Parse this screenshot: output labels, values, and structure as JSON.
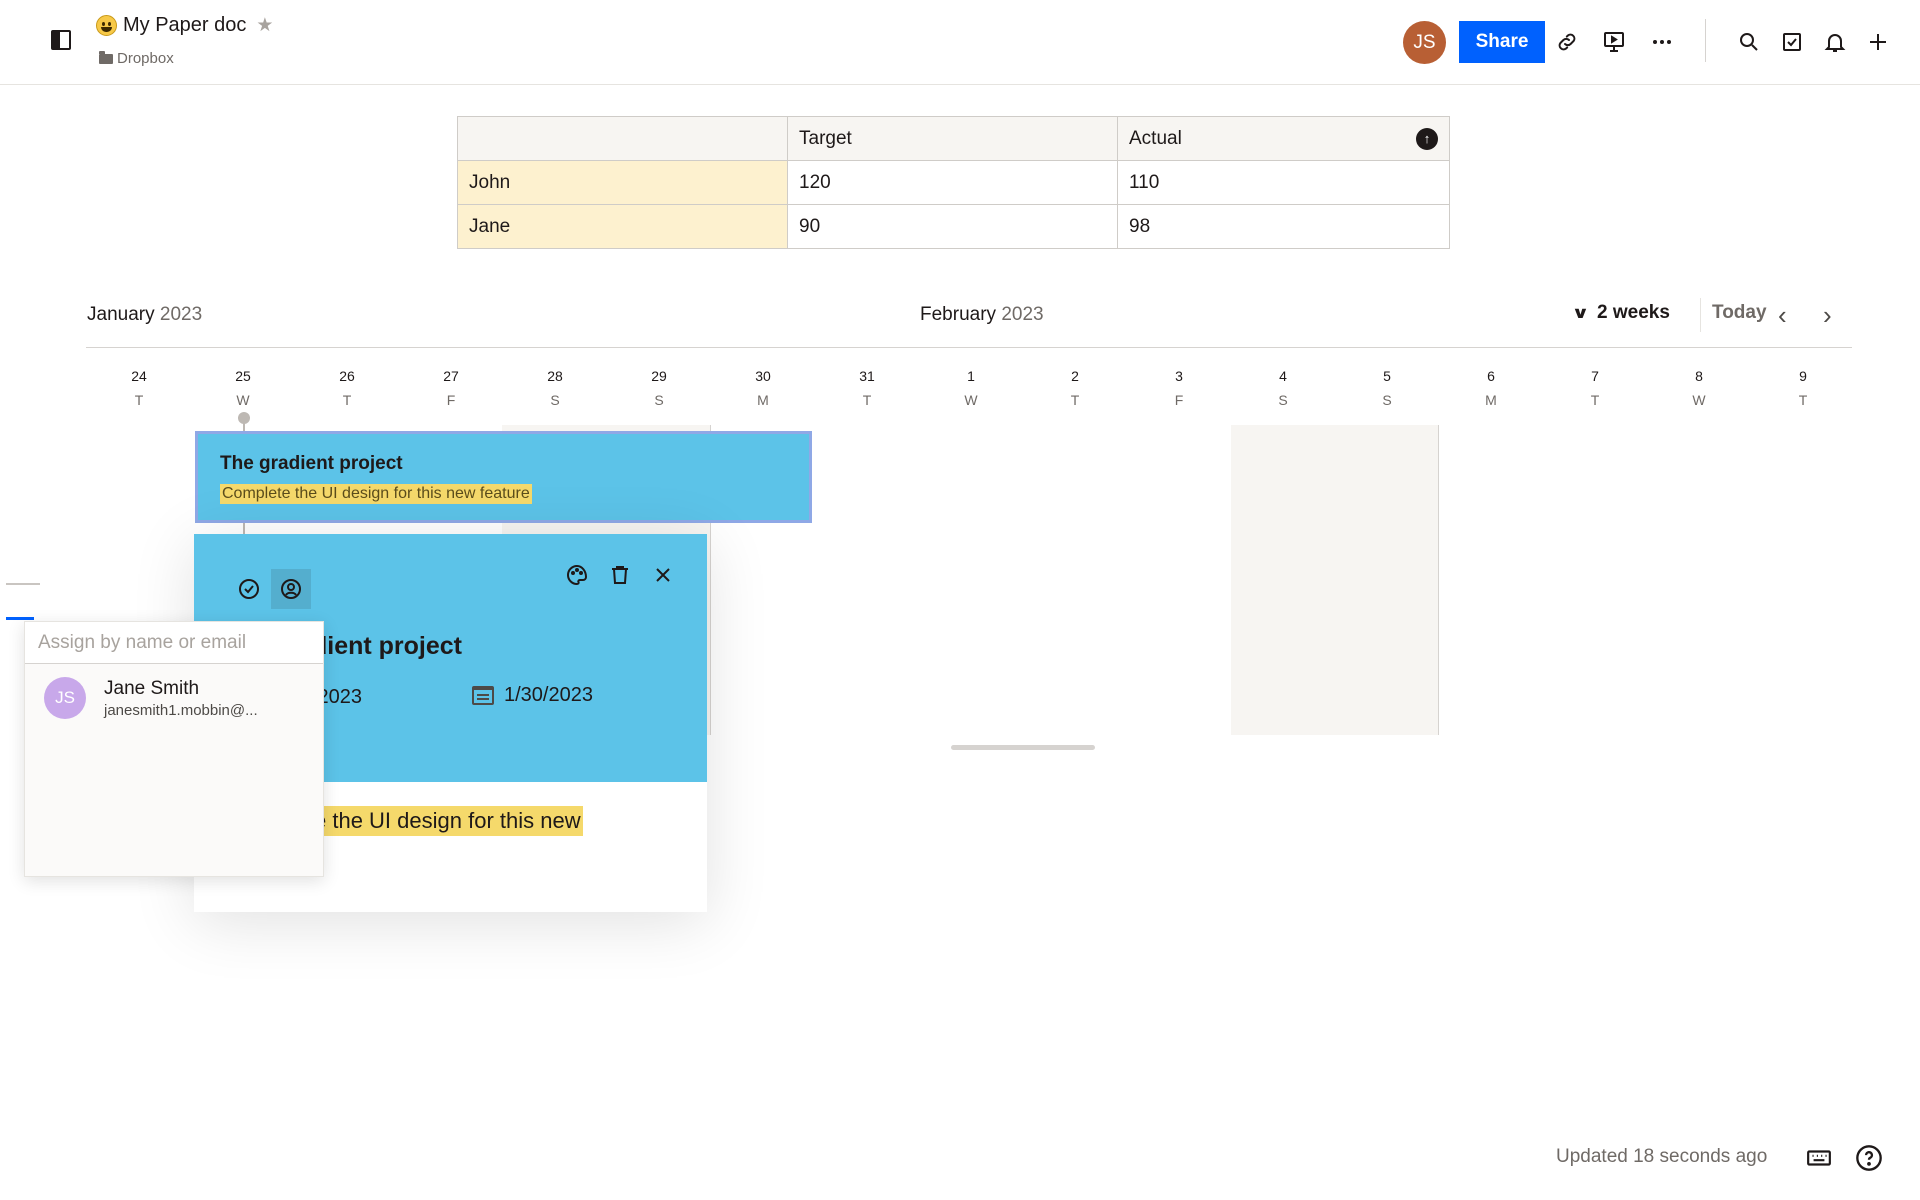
{
  "header": {
    "doc_title": "My Paper doc",
    "breadcrumb": "Dropbox",
    "avatar_initials": "JS",
    "avatar_color": "#b85f34",
    "share_label": "Share",
    "brand_color": "#0061fe",
    "icons": [
      "sidebar-toggle-icon",
      "emoji-icon",
      "star-icon",
      "folder-icon",
      "link-icon",
      "present-icon",
      "more-icon",
      "search-icon",
      "checklist-icon",
      "bell-icon",
      "plus-icon"
    ]
  },
  "table": {
    "headers": [
      "",
      "Target",
      "Actual"
    ],
    "rows": [
      [
        "John",
        "120",
        "110"
      ],
      [
        "Jane",
        "90",
        "98"
      ]
    ]
  },
  "timeline": {
    "months": [
      {
        "name": "January",
        "year": "2023"
      },
      {
        "name": "February",
        "year": "2023"
      }
    ],
    "range_label": "2 weeks",
    "today_label": "Today",
    "days": [
      {
        "num": "24",
        "letter": "T"
      },
      {
        "num": "25",
        "letter": "W"
      },
      {
        "num": "26",
        "letter": "T"
      },
      {
        "num": "27",
        "letter": "F"
      },
      {
        "num": "28",
        "letter": "S"
      },
      {
        "num": "29",
        "letter": "S"
      },
      {
        "num": "30",
        "letter": "M"
      },
      {
        "num": "31",
        "letter": "T"
      },
      {
        "num": "1",
        "letter": "W"
      },
      {
        "num": "2",
        "letter": "T"
      },
      {
        "num": "3",
        "letter": "F"
      },
      {
        "num": "4",
        "letter": "S"
      },
      {
        "num": "5",
        "letter": "S"
      },
      {
        "num": "6",
        "letter": "M"
      },
      {
        "num": "7",
        "letter": "T"
      },
      {
        "num": "8",
        "letter": "W"
      },
      {
        "num": "9",
        "letter": "T"
      }
    ],
    "project": {
      "title": "The gradient project",
      "description": "Complete the UI design for this new feature",
      "color": "#5cc3e8"
    }
  },
  "detail_card": {
    "title_visible": "dient project",
    "start_date_visible": "/2023",
    "end_date": "1/30/2023",
    "description_visible": "e the UI design for this new",
    "icons": [
      "check-circle-icon",
      "assign-user-icon",
      "palette-icon",
      "trash-icon",
      "close-icon"
    ]
  },
  "assign_popover": {
    "placeholder": "Assign by name or email",
    "suggestions": [
      {
        "initials": "JS",
        "name": "Jane Smith",
        "email": "janesmith1.mobbin@..."
      }
    ]
  },
  "footer": {
    "updated_text": "Updated 18 seconds ago",
    "icons": [
      "keyboard-icon",
      "help-icon"
    ]
  }
}
